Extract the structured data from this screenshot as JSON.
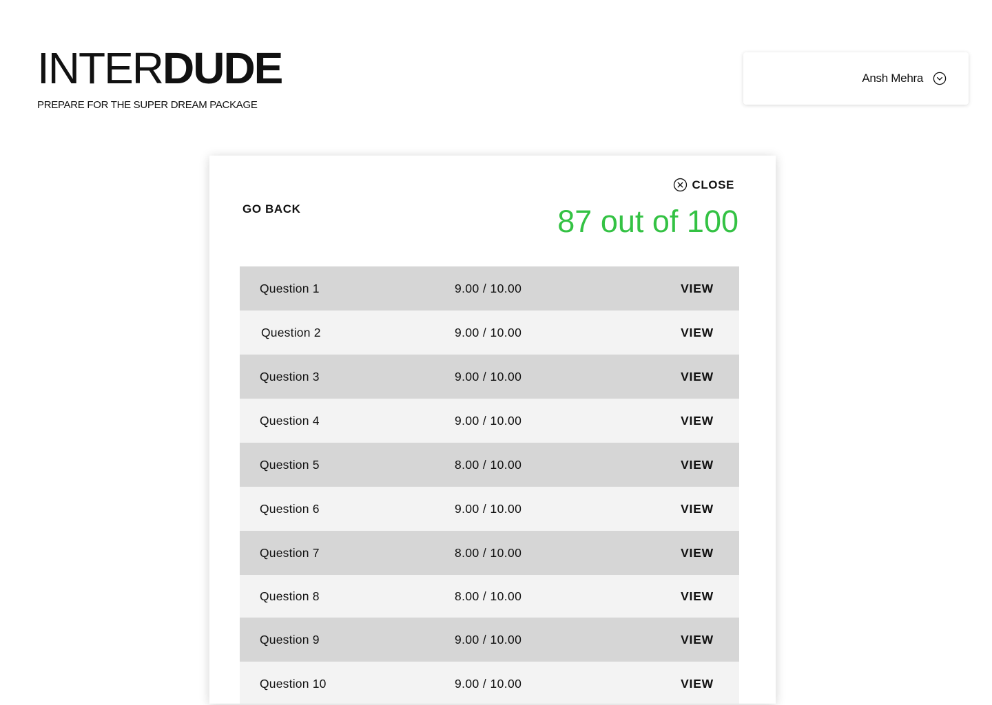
{
  "brand": {
    "logo_light": "INTER",
    "logo_bold": "DUDE",
    "tagline": "PREPARE FOR THE SUPER DREAM PACKAGE"
  },
  "user": {
    "name": "Ansh Mehra",
    "menu_icon": "chevron-down-circle-icon"
  },
  "panel": {
    "close_label": "CLOSE",
    "close_icon": "close-circle-icon",
    "go_back_label": "GO BACK",
    "score_text": "87 out of 100",
    "score_color": "#34c244"
  },
  "questions": [
    {
      "label": "Question 1",
      "score": "9.00 / 10.00",
      "action": "VIEW"
    },
    {
      "label": "Question 2",
      "score": "9.00 / 10.00",
      "action": "VIEW"
    },
    {
      "label": "Question 3",
      "score": "9.00 / 10.00",
      "action": "VIEW"
    },
    {
      "label": "Question 4",
      "score": "9.00 / 10.00",
      "action": "VIEW"
    },
    {
      "label": "Question 5",
      "score": "8.00 / 10.00",
      "action": "VIEW"
    },
    {
      "label": "Question 6",
      "score": "9.00 / 10.00",
      "action": "VIEW"
    },
    {
      "label": "Question 7",
      "score": "8.00 / 10.00",
      "action": "VIEW"
    },
    {
      "label": "Question 8",
      "score": "8.00 / 10.00",
      "action": "VIEW"
    },
    {
      "label": "Question 9",
      "score": "9.00 / 10.00",
      "action": "VIEW"
    },
    {
      "label": "Question 10",
      "score": "9.00 / 10.00",
      "action": "VIEW"
    }
  ]
}
